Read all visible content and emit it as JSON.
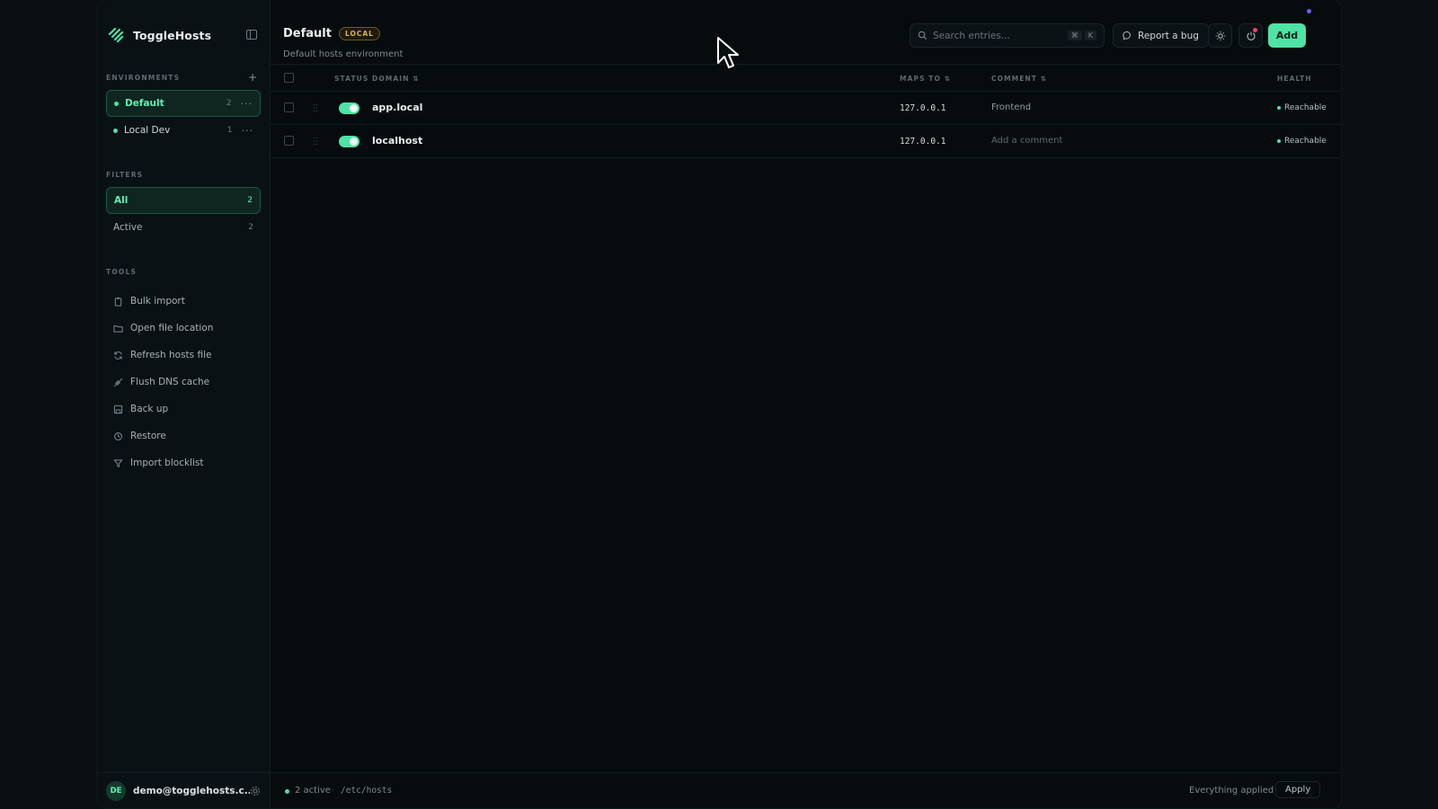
{
  "app": {
    "name": "ToggleHosts",
    "accent": "#4fe3a5"
  },
  "sidebar": {
    "environments_label": "ENVIRONMENTS",
    "environments": [
      {
        "name": "Default",
        "count": "2",
        "active": true
      },
      {
        "name": "Local Dev",
        "count": "1",
        "active": false
      }
    ],
    "filters_label": "FILTERS",
    "filters": [
      {
        "name": "All",
        "count": "2",
        "active": true
      },
      {
        "name": "Active",
        "count": "2",
        "active": false
      }
    ],
    "tools_label": "TOOLS",
    "tools": [
      {
        "label": "Bulk import",
        "icon": "clipboard-icon"
      },
      {
        "label": "Open file location",
        "icon": "folder-icon"
      },
      {
        "label": "Refresh hosts file",
        "icon": "refresh-icon"
      },
      {
        "label": "Flush DNS cache",
        "icon": "rocket-icon"
      },
      {
        "label": "Back up",
        "icon": "save-icon"
      },
      {
        "label": "Restore",
        "icon": "history-icon"
      },
      {
        "label": "Import blocklist",
        "icon": "filter-icon"
      }
    ],
    "user": {
      "initials": "DE",
      "email": "demo@togglehosts.c..."
    }
  },
  "header": {
    "title": "Default",
    "badge": "LOCAL",
    "subtitle": "Default hosts environment",
    "search_placeholder": "Search entries...",
    "search_kbd": [
      "⌘",
      "K"
    ],
    "report_bug": "Report a bug",
    "add_label": "Add"
  },
  "table": {
    "columns": {
      "status": "STATUS",
      "domain": "DOMAIN",
      "maps_to": "MAPS TO",
      "comment": "COMMENT",
      "health": "HEALTH"
    },
    "rows": [
      {
        "enabled": true,
        "domain": "app.local",
        "ip": "127.0.0.1",
        "comment": "Frontend",
        "health": "Reachable"
      },
      {
        "enabled": true,
        "domain": "localhost",
        "ip": "127.0.0.1",
        "comment": "Add a comment",
        "health": "Reachable"
      }
    ]
  },
  "footer": {
    "active": "2 active",
    "separator": "·",
    "path": "/etc/hosts",
    "status": "Everything applied",
    "apply": "Apply"
  }
}
